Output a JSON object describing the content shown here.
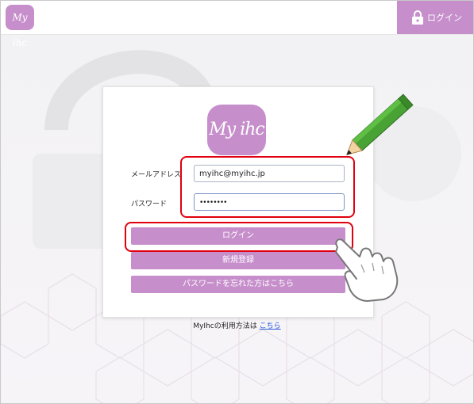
{
  "header": {
    "logo_text": "My ihc",
    "login_label": "ログイン"
  },
  "card": {
    "logo_text": "My ihc",
    "email_label": "メールアドレス",
    "email_value": "myihc@myihc.jp",
    "password_label": "パスワード",
    "password_value": "••••••••",
    "login_button": "ログイン",
    "register_button": "新規登録",
    "forgot_button": "パスワードを忘れた方はこちら"
  },
  "help": {
    "text": "MyIhcの利用方法は",
    "link": "こちら"
  },
  "colors": {
    "brand": "#c68fcb",
    "highlight": "#e1000f",
    "link": "#2a5bd7"
  },
  "icons": [
    "lock-icon",
    "pencil-icon",
    "pointing-hand-icon"
  ]
}
